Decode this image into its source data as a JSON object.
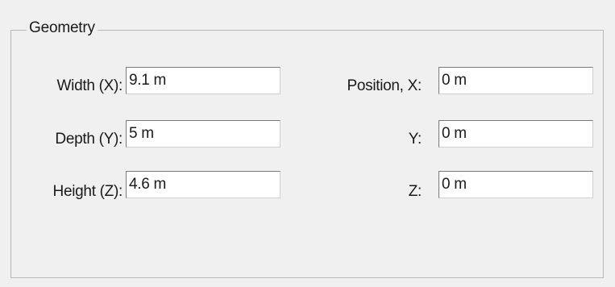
{
  "group": {
    "title": "Geometry"
  },
  "fields": {
    "width": {
      "label": "Width (X):",
      "value": "9.1 m"
    },
    "depth": {
      "label": "Depth (Y):",
      "value": "5 m"
    },
    "height": {
      "label": "Height (Z):",
      "value": "4.6 m"
    },
    "pos_x": {
      "label": "Position, X:",
      "value": "0 m"
    },
    "pos_y": {
      "label": "Y:",
      "value": "0 m"
    },
    "pos_z": {
      "label": "Z:",
      "value": "0 m"
    }
  }
}
